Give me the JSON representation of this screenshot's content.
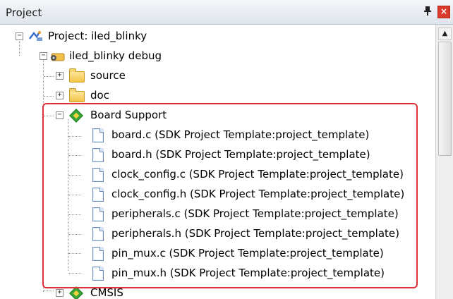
{
  "panel": {
    "title": "Project",
    "pin_glyph": "Ͱ",
    "close_glyph": "×"
  },
  "tree": {
    "project": "Project: iled_blinky",
    "target": "iled_blinky debug",
    "folders": {
      "source": "source",
      "doc": "doc",
      "board_support": "Board Support",
      "cmsis": "CMSIS"
    },
    "files": [
      "board.c (SDK Project Template:project_template)",
      "board.h (SDK Project Template:project_template)",
      "clock_config.c (SDK Project Template:project_template)",
      "clock_config.h (SDK Project Template:project_template)",
      "peripherals.c (SDK Project Template:project_template)",
      "peripherals.h (SDK Project Template:project_template)",
      "pin_mux.c (SDK Project Template:project_template)",
      "pin_mux.h (SDK Project Template:project_template)"
    ],
    "expanded_symbol": "−",
    "collapsed_symbol": "+"
  },
  "scrollbar": {
    "up_glyph": "▲"
  },
  "colors": {
    "highlight": "#e0303a",
    "close": "#d93a2b"
  }
}
